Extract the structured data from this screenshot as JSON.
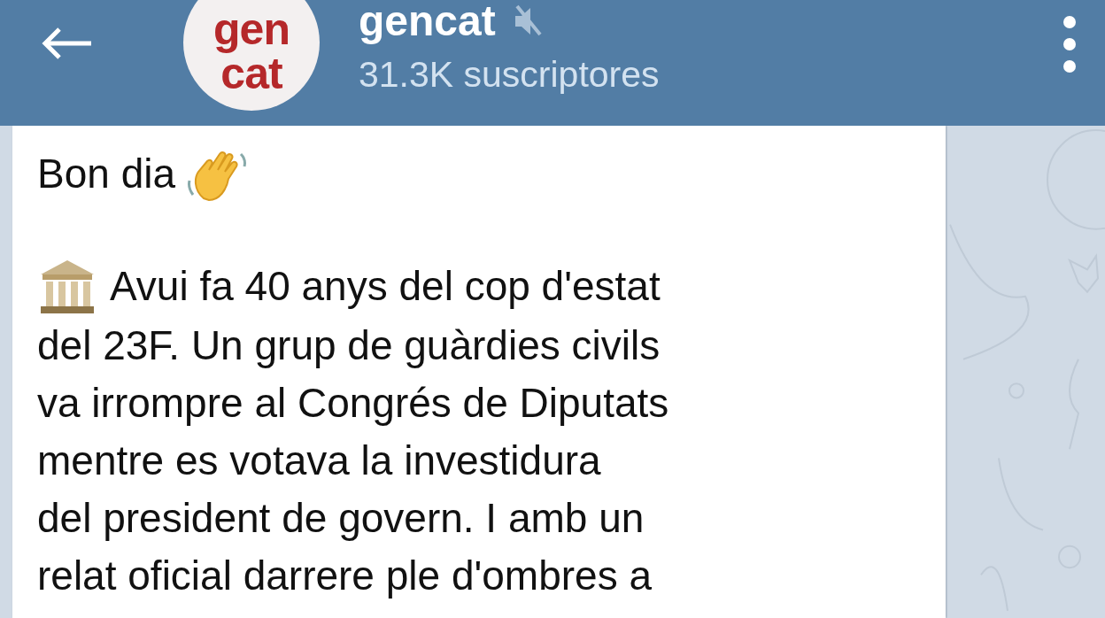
{
  "header": {
    "channel": {
      "name": "gencat",
      "muted": true,
      "subscribers": "31.3K suscriptores"
    },
    "avatar": {
      "lines": [
        "gen",
        "cat"
      ]
    }
  },
  "message": {
    "paragraphs": [
      {
        "lines": [
          "Bon dia"
        ]
      },
      {
        "lines": [
          "Avui fa 40 anys del cop d'estat",
          "del 23F. Un grup de guàrdies civils",
          "va irrompre al Congrés de Diputats",
          "mentre es votava la investidura",
          "del president de govern. I amb un",
          "relat oficial darrere ple d'ombres a"
        ]
      }
    ]
  }
}
